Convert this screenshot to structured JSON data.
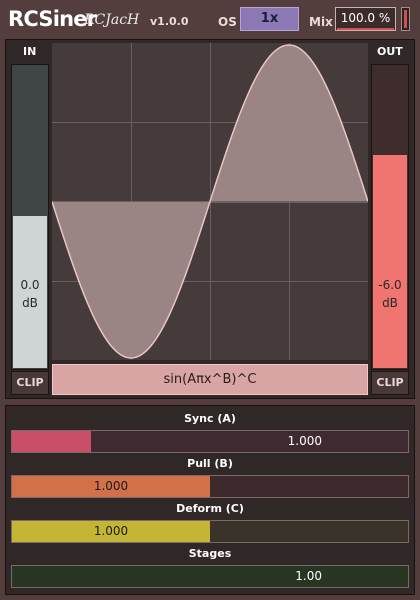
{
  "header": {
    "brand": "RCSiner",
    "brand_sub": "RCJacH",
    "version": "v1.0.0",
    "os_label": "OS",
    "os_value": "1x",
    "mix_label": "Mix",
    "mix_value": "100.0 %",
    "mix_level": 1.0
  },
  "meters": {
    "in": {
      "title": "IN",
      "value": "0.0",
      "unit": "dB",
      "level": 0.5,
      "clip_label": "CLIP"
    },
    "out": {
      "title": "OUT",
      "value": "-6.0",
      "unit": "dB",
      "level": 0.7,
      "clip_label": "CLIP"
    }
  },
  "graph": {
    "formula": "sin(Aπx^B)^C",
    "grid_on": true,
    "curve_color": "#e8c6c6",
    "fill_color": "#9a8484"
  },
  "params": [
    {
      "label": "Sync (A)",
      "value_text": "1.000",
      "level": 0.2,
      "color": "#c94f68",
      "track": "#3e2a30",
      "align": "right"
    },
    {
      "label": "Pull (B)",
      "value_text": "1.000",
      "level": 0.5,
      "color": "#d2704a",
      "track": "#3e2a2c",
      "align": "center-fill"
    },
    {
      "label": "Deform (C)",
      "value_text": "1.000",
      "level": 0.5,
      "color": "#c4b534",
      "track": "#3a332a",
      "align": "center-fill"
    },
    {
      "label": "Stages",
      "value_text": "1.00",
      "level": 0.0,
      "color": "#4c7a3c",
      "track": "#283522",
      "align": "right"
    }
  ]
}
